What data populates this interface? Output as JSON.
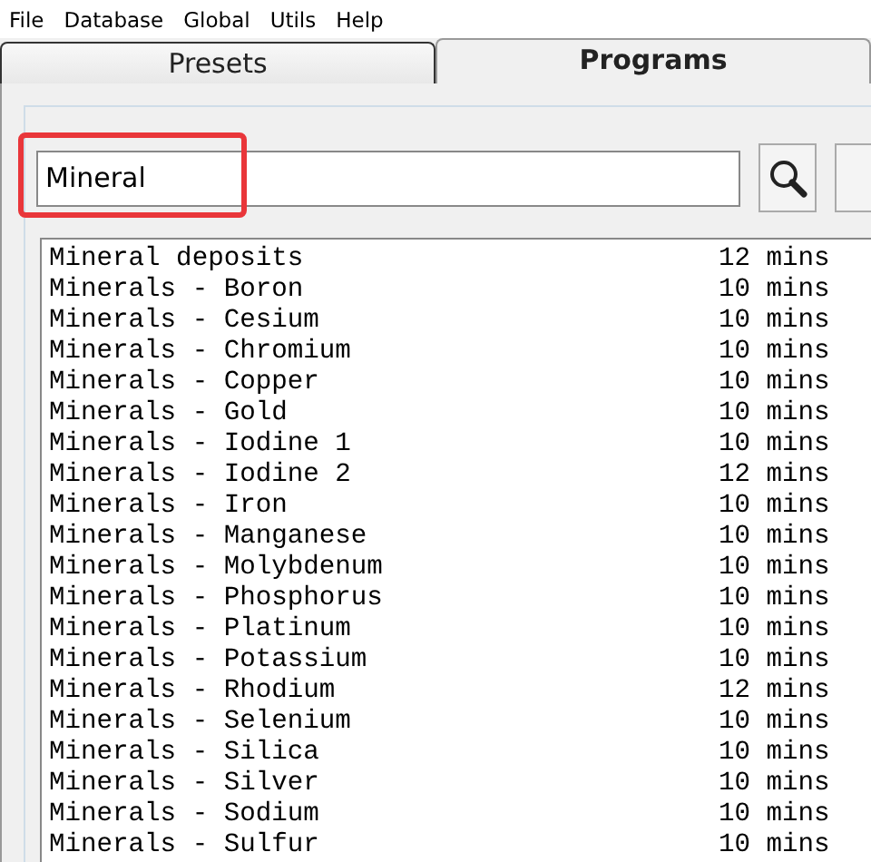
{
  "menu": [
    "File",
    "Database",
    "Global",
    "Utils",
    "Help"
  ],
  "tabs": [
    {
      "label": "Presets",
      "selected": false
    },
    {
      "label": "Programs",
      "selected": true
    }
  ],
  "search": {
    "value": "Mineral",
    "highlighted": true
  },
  "programs": [
    {
      "name": "Mineral deposits",
      "duration": "12 mins"
    },
    {
      "name": "Minerals - Boron",
      "duration": "10 mins"
    },
    {
      "name": "Minerals - Cesium",
      "duration": "10 mins"
    },
    {
      "name": "Minerals - Chromium",
      "duration": "10 mins"
    },
    {
      "name": "Minerals - Copper",
      "duration": "10 mins"
    },
    {
      "name": "Minerals - Gold",
      "duration": "10 mins"
    },
    {
      "name": "Minerals - Iodine 1",
      "duration": "10 mins"
    },
    {
      "name": "Minerals - Iodine 2",
      "duration": "12 mins"
    },
    {
      "name": "Minerals - Iron",
      "duration": "10 mins"
    },
    {
      "name": "Minerals - Manganese",
      "duration": "10 mins"
    },
    {
      "name": "Minerals - Molybdenum",
      "duration": "10 mins"
    },
    {
      "name": "Minerals - Phosphorus",
      "duration": "10 mins"
    },
    {
      "name": "Minerals - Platinum",
      "duration": "10 mins"
    },
    {
      "name": "Minerals - Potassium",
      "duration": "10 mins"
    },
    {
      "name": "Minerals - Rhodium",
      "duration": "12 mins"
    },
    {
      "name": "Minerals - Selenium",
      "duration": "10 mins"
    },
    {
      "name": "Minerals - Silica",
      "duration": "10 mins"
    },
    {
      "name": "Minerals - Silver",
      "duration": "10 mins"
    },
    {
      "name": "Minerals - Sodium",
      "duration": "10 mins"
    },
    {
      "name": "Minerals - Sulfur",
      "duration": "10 mins"
    }
  ]
}
